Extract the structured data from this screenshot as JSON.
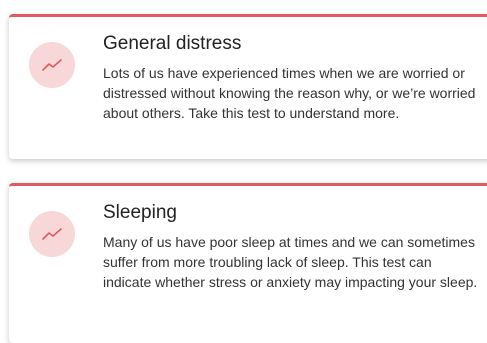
{
  "cards": [
    {
      "icon": "trend-line-icon",
      "title": "General distress",
      "description": "Lots of us have experienced times when we are worried or distressed without knowing the reason why, or we’re worried about others. Take this test to understand more."
    },
    {
      "icon": "trend-line-icon",
      "title": "Sleeping",
      "description": "Many of us have poor sleep at times and we can sometimes suffer from more troubling lack of sleep. This test can indicate whether stress or anxiety may impacting your sleep."
    }
  ],
  "colors": {
    "accent": "#e05a5f",
    "icon_bg": "#f7d7d8",
    "title": "#222222",
    "text": "#333333"
  }
}
